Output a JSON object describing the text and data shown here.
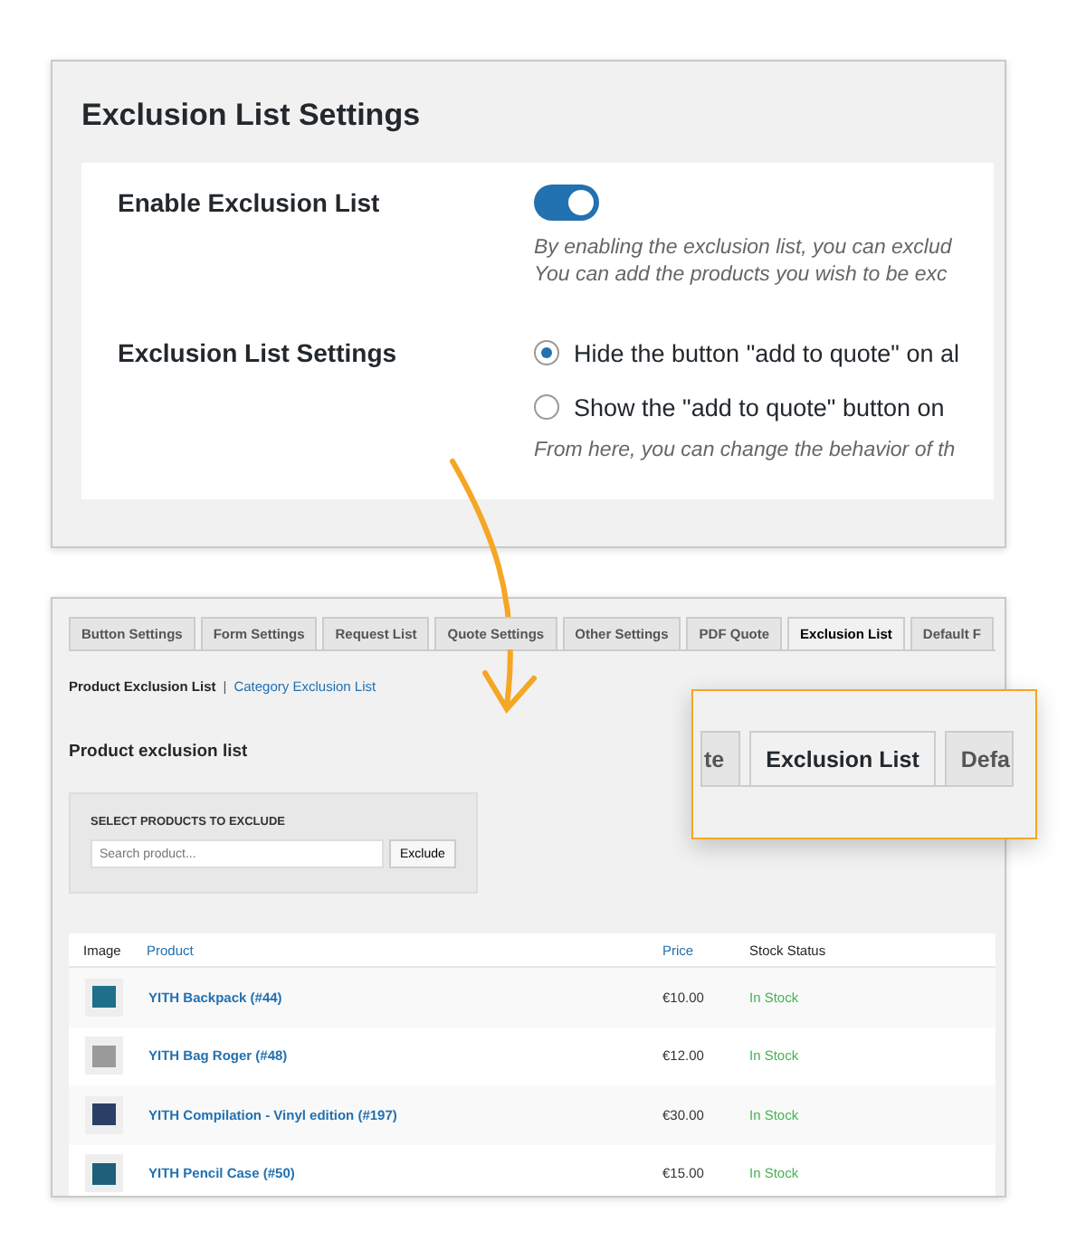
{
  "settings_panel": {
    "title": "Exclusion List Settings",
    "rows": [
      {
        "kind": "toggle",
        "label": "Enable Exclusion List",
        "on": true,
        "description": [
          "By enabling the exclusion list, you can exclud",
          "You can add the products you wish to be exc"
        ]
      },
      {
        "kind": "radio",
        "label": "Exclusion List Settings",
        "options": [
          {
            "label": "Hide the button \"add to quote\" on al",
            "selected": true
          },
          {
            "label": "Show the \"add to quote\" button on",
            "selected": false
          }
        ],
        "description": [
          "From here, you can change the behavior of th"
        ]
      }
    ]
  },
  "admin_panel": {
    "tabs": [
      {
        "label": "Button Settings",
        "selected": false
      },
      {
        "label": "Form Settings",
        "selected": false
      },
      {
        "label": "Request List",
        "selected": false
      },
      {
        "label": "Quote Settings",
        "selected": false
      },
      {
        "label": "Other Settings",
        "selected": false
      },
      {
        "label": "PDF Quote",
        "selected": false
      },
      {
        "label": "Exclusion List",
        "selected": true
      },
      {
        "label": "Default F",
        "selected": false
      }
    ],
    "sub_links": [
      {
        "label": "Product Exclusion List",
        "selected": true
      },
      {
        "label": "Category Exclusion List",
        "selected": false
      }
    ],
    "separator": "|",
    "heading": "Product exclusion list",
    "exclude_box": {
      "title": "SELECT PRODUCTS TO EXCLUDE",
      "placeholder": "Search product...",
      "button": "Exclude"
    },
    "table": {
      "columns": [
        "Image",
        "Product",
        "Price",
        "Stock Status"
      ],
      "rows": [
        {
          "product": "YITH Backpack (#44)",
          "price": "€10.00",
          "stock": "In Stock",
          "color": "#1e6f8a"
        },
        {
          "product": "YITH Bag Roger (#48)",
          "price": "€12.00",
          "stock": "In Stock",
          "color": "#9a9a9a"
        },
        {
          "product": "YITH Compilation - Vinyl edition (#197)",
          "price": "€30.00",
          "stock": "In Stock",
          "color": "#2a3f66"
        },
        {
          "product": "YITH Pencil Case (#50)",
          "price": "€15.00",
          "stock": "In Stock",
          "color": "#1e5f7a"
        }
      ]
    }
  },
  "zoom_callout": {
    "tabs": [
      {
        "label": "te",
        "selected": false
      },
      {
        "label": "Exclusion List",
        "selected": true
      },
      {
        "label": "Defa",
        "selected": false
      }
    ]
  }
}
